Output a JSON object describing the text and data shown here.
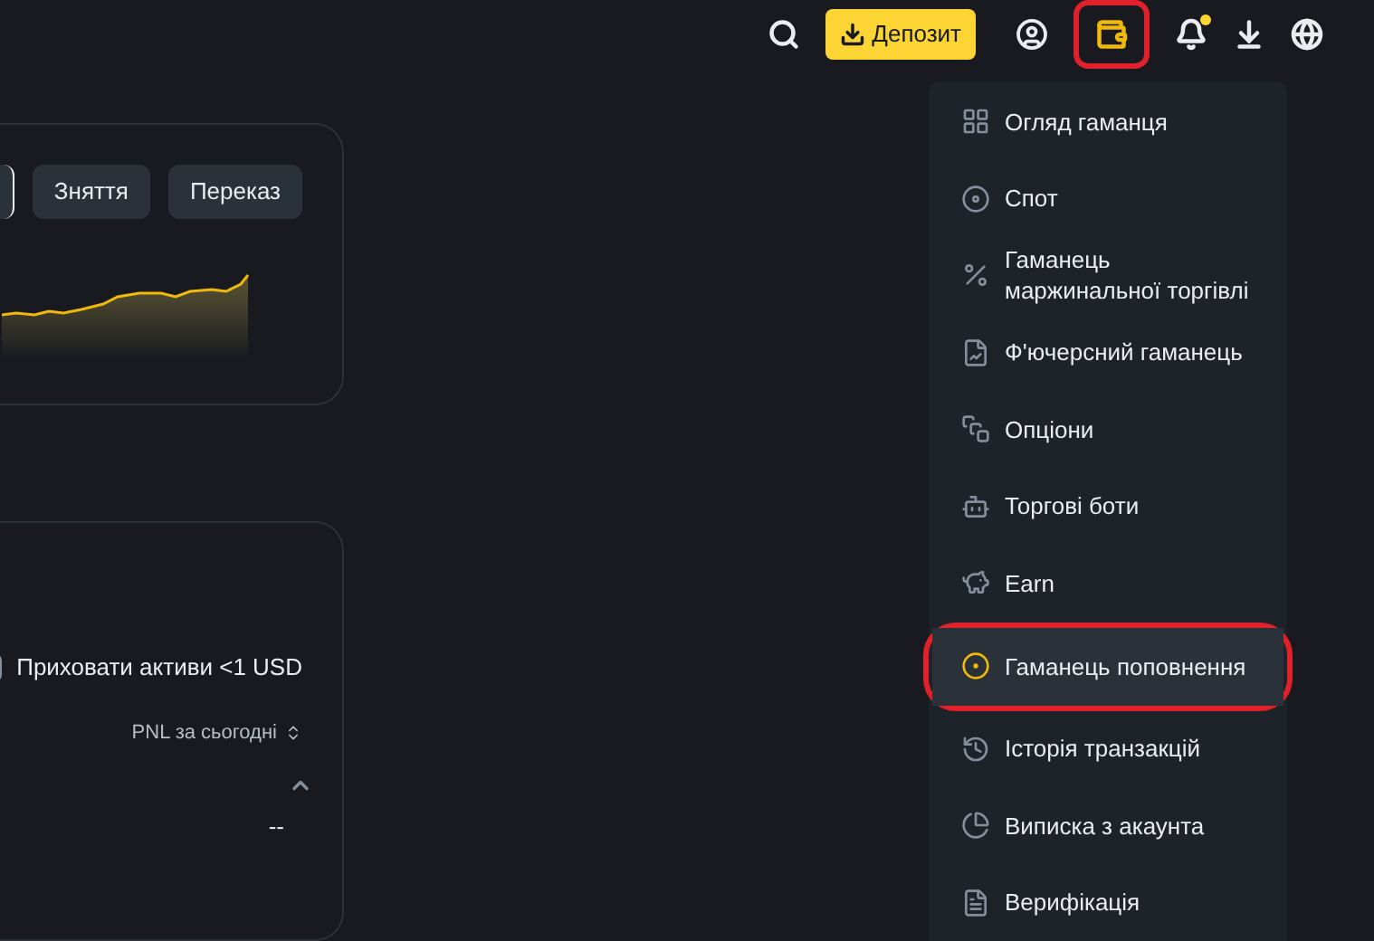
{
  "topbar": {
    "deposit_button": "Депозит",
    "wallet_highlighted": true,
    "notification_dot": true
  },
  "balance_card": {
    "buttons": [
      "Зняття",
      "Переказ"
    ]
  },
  "assets_card": {
    "hide_small": {
      "label": "Приховати активи <1 USD",
      "checked": false
    },
    "sort_label": "PNL за сьогодні",
    "pnl_value": "--"
  },
  "wallet_menu": {
    "items": [
      {
        "kind": "overview",
        "label": "Огляд гаманця",
        "selected": false,
        "highlighted": false
      },
      {
        "kind": "spot",
        "label": "Спот",
        "selected": false,
        "highlighted": false
      },
      {
        "kind": "margin",
        "label": "Гаманець маржинальної торгівлі",
        "selected": false,
        "highlighted": false
      },
      {
        "kind": "futures",
        "label": "Ф'ючерсний гаманець",
        "selected": false,
        "highlighted": false
      },
      {
        "kind": "options",
        "label": "Опціони",
        "selected": false,
        "highlighted": false
      },
      {
        "kind": "bots",
        "label": "Торгові боти",
        "selected": false,
        "highlighted": false
      },
      {
        "kind": "earn",
        "label": "Earn",
        "selected": false,
        "highlighted": false
      },
      {
        "kind": "funding",
        "label": "Гаманець поповнення",
        "selected": true,
        "highlighted": true
      },
      {
        "kind": "history",
        "label": "Історія транзакцій",
        "selected": false,
        "highlighted": false
      },
      {
        "kind": "statement",
        "label": "Виписка з акаунта",
        "selected": false,
        "highlighted": false
      },
      {
        "kind": "verification",
        "label": "Верифікація",
        "selected": false,
        "highlighted": false
      }
    ]
  }
}
